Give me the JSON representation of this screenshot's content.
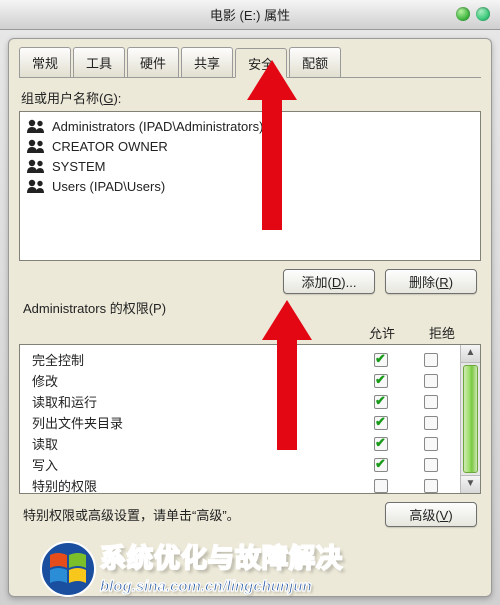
{
  "titlebar": {
    "title": "电影 (E:) 属性"
  },
  "tabs": [
    {
      "label": "常规",
      "active": false
    },
    {
      "label": "工具",
      "active": false
    },
    {
      "label": "硬件",
      "active": false
    },
    {
      "label": "共享",
      "active": false
    },
    {
      "label": "安全",
      "active": true
    },
    {
      "label": "配额",
      "active": false
    }
  ],
  "group_label_prefix": "组或用户名称(",
  "group_label_hot": "G",
  "group_label_suffix": "):",
  "users": [
    {
      "name": "Administrators (IPAD\\Administrators)"
    },
    {
      "name": "CREATOR OWNER"
    },
    {
      "name": "SYSTEM"
    },
    {
      "name": "Users (IPAD\\Users)"
    }
  ],
  "buttons": {
    "add_prefix": "添加(",
    "add_hot": "D",
    "add_suffix": ")...",
    "remove_prefix": "删除(",
    "remove_hot": "R",
    "remove_suffix": ")"
  },
  "perm_label_prefix": "Administrators 的权限(",
  "perm_label_hot": "P",
  "perm_label_suffix": ")",
  "perm_headers": {
    "allow": "允许",
    "deny": "拒绝"
  },
  "permissions": [
    {
      "name": "完全控制",
      "allow": true,
      "deny": false
    },
    {
      "name": "修改",
      "allow": true,
      "deny": false
    },
    {
      "name": "读取和运行",
      "allow": true,
      "deny": false
    },
    {
      "name": "列出文件夹目录",
      "allow": true,
      "deny": false
    },
    {
      "name": "读取",
      "allow": true,
      "deny": false
    },
    {
      "name": "写入",
      "allow": true,
      "deny": false
    },
    {
      "name": "特别的权限",
      "allow": false,
      "deny": false
    }
  ],
  "advanced_text": "特别权限或高级设置，请单击“高级”。",
  "advanced_btn_prefix": "高级(",
  "advanced_btn_hot": "V",
  "advanced_btn_suffix": ")",
  "watermark": {
    "title": "系统优化与故障解决",
    "url": "blog.sina.com.cn/lingchunjun"
  }
}
